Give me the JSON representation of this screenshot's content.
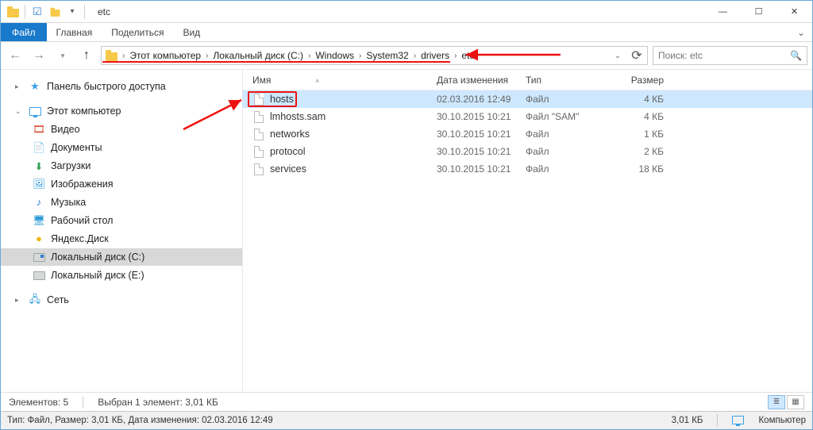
{
  "window": {
    "title": "etc"
  },
  "ribbon": {
    "file": "Файл",
    "tabs": [
      "Главная",
      "Поделиться",
      "Вид"
    ]
  },
  "breadcrumbs": [
    "Этот компьютер",
    "Локальный диск (C:)",
    "Windows",
    "System32",
    "drivers",
    "etc"
  ],
  "search": {
    "placeholder": "Поиск: etc"
  },
  "tree": {
    "quick_access": "Панель быстрого доступа",
    "this_pc": "Этот компьютер",
    "items": [
      {
        "label": "Видео",
        "icon": "video"
      },
      {
        "label": "Документы",
        "icon": "doc"
      },
      {
        "label": "Загрузки",
        "icon": "down"
      },
      {
        "label": "Изображения",
        "icon": "pic"
      },
      {
        "label": "Музыка",
        "icon": "music"
      },
      {
        "label": "Рабочий стол",
        "icon": "desk"
      },
      {
        "label": "Яндекс.Диск",
        "icon": "ydisk"
      },
      {
        "label": "Локальный диск (C:)",
        "icon": "diskc",
        "selected": true
      },
      {
        "label": "Локальный диск (E:)",
        "icon": "disk"
      }
    ],
    "network": "Сеть"
  },
  "columns": {
    "name": "Имя",
    "date": "Дата изменения",
    "type": "Тип",
    "size": "Размер"
  },
  "files": [
    {
      "name": "hosts",
      "date": "02.03.2016 12:49",
      "type": "Файл",
      "size": "4 КБ",
      "selected": true
    },
    {
      "name": "lmhosts.sam",
      "date": "30.10.2015 10:21",
      "type": "Файл \"SAM\"",
      "size": "4 КБ"
    },
    {
      "name": "networks",
      "date": "30.10.2015 10:21",
      "type": "Файл",
      "size": "1 КБ"
    },
    {
      "name": "protocol",
      "date": "30.10.2015 10:21",
      "type": "Файл",
      "size": "2 КБ"
    },
    {
      "name": "services",
      "date": "30.10.2015 10:21",
      "type": "Файл",
      "size": "18 КБ"
    }
  ],
  "status": {
    "elements": "Элементов: 5",
    "selected": "Выбран 1 элемент: 3,01 КБ",
    "details": "Тип: Файл, Размер: 3,01 КБ, Дата изменения: 02.03.2016 12:49",
    "size_right": "3,01 КБ",
    "computer": "Компьютер"
  }
}
